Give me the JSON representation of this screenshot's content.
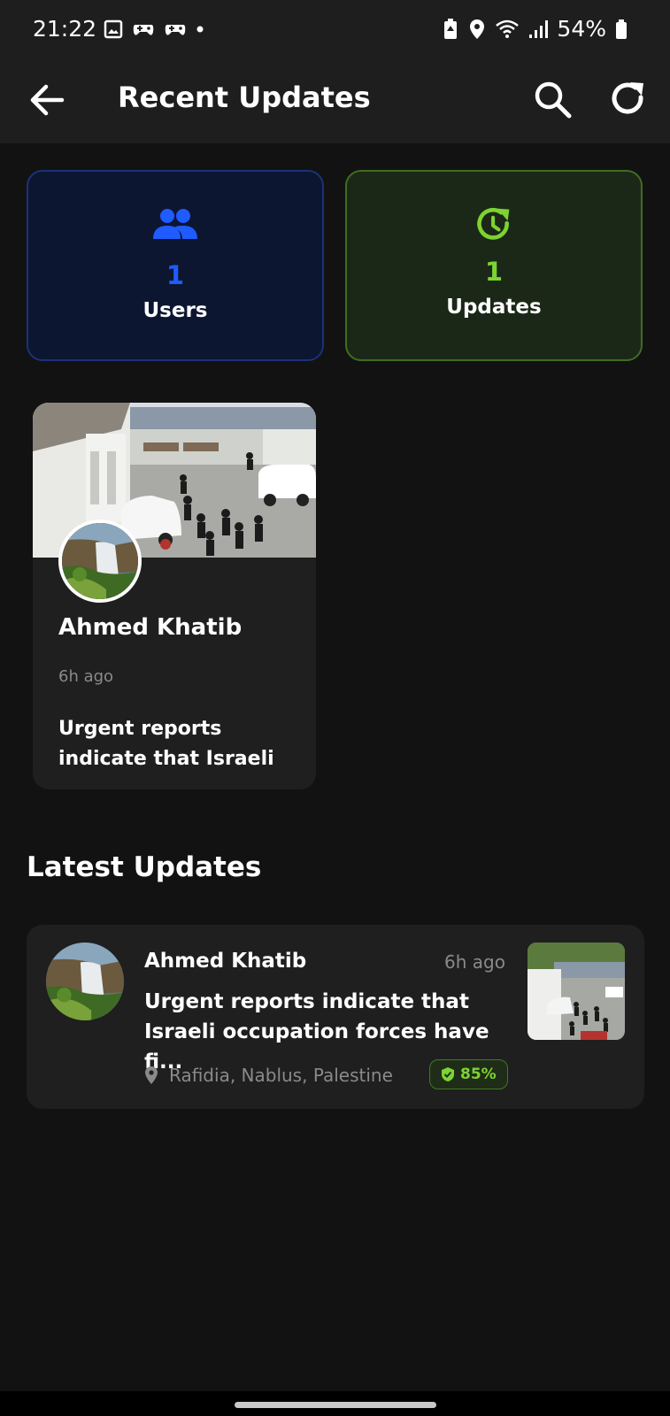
{
  "status_bar": {
    "time": "21:22",
    "battery": "54%"
  },
  "app_bar": {
    "title": "Recent Updates",
    "back_icon": "arrow-left-icon",
    "search_icon": "search-icon",
    "refresh_icon": "refresh-icon"
  },
  "stats": {
    "users": {
      "value": "1",
      "label": "Users",
      "color": "#1f5bff"
    },
    "updates": {
      "value": "1",
      "label": "Updates",
      "color": "#7dd332"
    }
  },
  "featured": {
    "name": "Ahmed Khatib",
    "time": "6h ago",
    "text": "Urgent reports indicate that Israeli ..."
  },
  "latest": {
    "title": "Latest Updates",
    "items": [
      {
        "name": "Ahmed Khatib",
        "time": "6h ago",
        "line1": "Urgent reports indicate that",
        "line2": "Israeli occupation forces have fi...",
        "location": "Rafidia, Nablus, Palestine",
        "confidence": "85%"
      }
    ]
  }
}
